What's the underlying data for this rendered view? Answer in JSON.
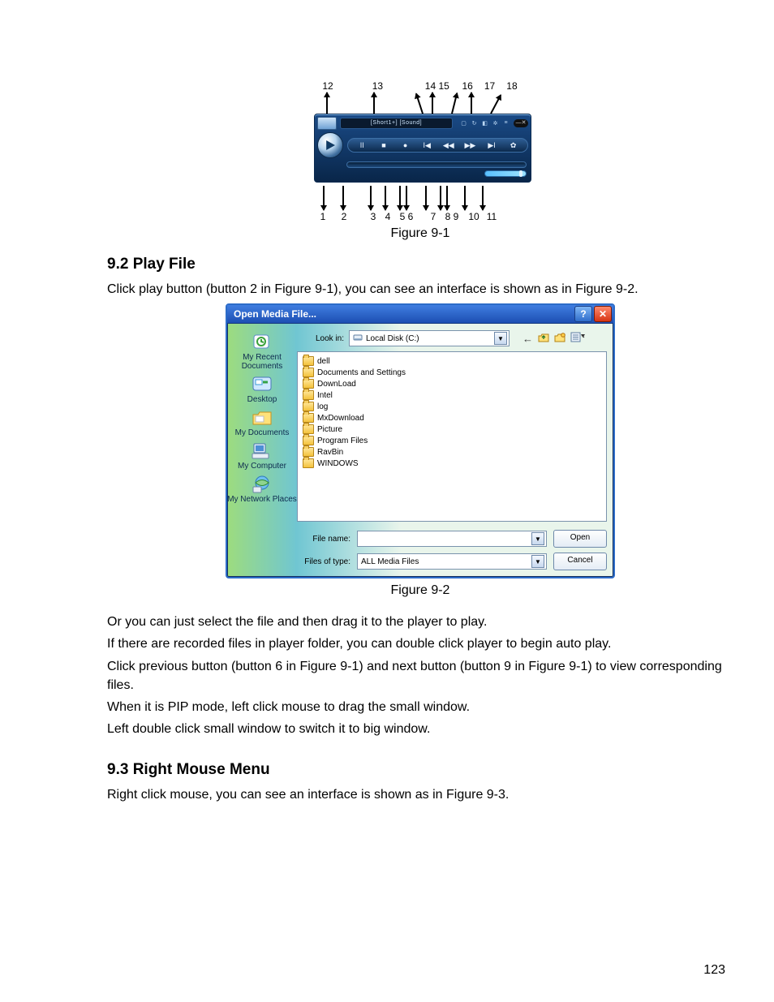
{
  "fig1": {
    "caption": "Figure 9-1",
    "top_numbers": [
      "12",
      "13",
      "14 15",
      "16",
      "17",
      "18"
    ],
    "display_text": "[Short1+] [Sound]",
    "bottom_numbers": [
      "1",
      "2",
      "3",
      "4",
      "5 6",
      "7",
      "8 9",
      "10",
      "11"
    ]
  },
  "section92": {
    "heading": "9.2  Play File",
    "p1": "Click play button (button 2 in Figure 9-1), you can see an interface is shown as in Figure 9-2."
  },
  "fig2": {
    "caption": "Figure 9-2",
    "dialog": {
      "title": "Open Media File...",
      "lookin_label": "Look in:",
      "lookin_value": "Local Disk (C:)",
      "sidebar": [
        "My Recent Documents",
        "Desktop",
        "My Documents",
        "My Computer",
        "My Network Places"
      ],
      "folders": [
        "dell",
        "Documents and Settings",
        "DownLoad",
        "Intel",
        "log",
        "MxDownload",
        "Picture",
        "Program Files",
        "RavBin",
        "WINDOWS"
      ],
      "filename_label": "File name:",
      "filename_value": "",
      "type_label": "Files of type:",
      "type_value": "ALL Media Files",
      "open_btn": "Open",
      "cancel_btn": "Cancel"
    }
  },
  "paras": {
    "p2": "Or you can just select the file and then drag it to the player to play.",
    "p3": "If there are recorded files in player folder, you can double click player to begin auto play.",
    "p4": "Click previous button (button 6 in Figure 9-1) and next button (button 9 in Figure 9-1) to view corresponding files.",
    "p5": "When it is PIP mode, left click mouse to drag the small window.",
    "p6": "Left double click small window to switch it to big window."
  },
  "section93": {
    "heading": "9.3  Right Mouse Menu",
    "p1": "Right click mouse, you can see an interface is shown as in Figure 9-3."
  },
  "page_number": "123"
}
